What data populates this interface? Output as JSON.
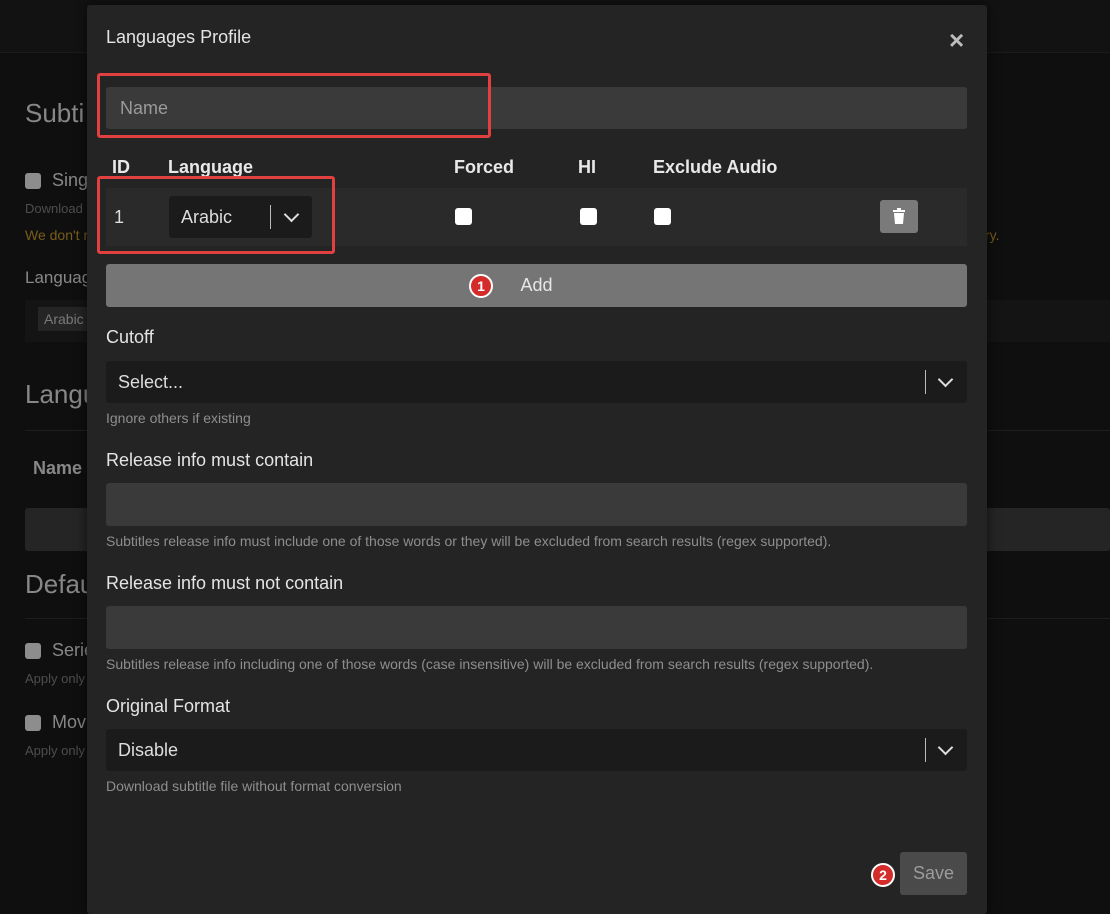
{
  "background": {
    "heading_subtitles": "Subti",
    "single_label": "Sing",
    "download_hint": "Download",
    "warning_left": "We don't r",
    "warning_right": "ry.",
    "languages_label": "Languag",
    "language_tag": "Arabic",
    "heading_languages": "Langu",
    "name_column": "Name",
    "heading_defaults": "Defau",
    "series_label": "Serie",
    "apply_only_1": "Apply only",
    "movies_label": "Mov",
    "apply_only_2": "Apply only"
  },
  "modal": {
    "title": "Languages Profile",
    "close_symbol": "×",
    "name_placeholder": "Name",
    "table": {
      "headers": {
        "id": "ID",
        "language": "Language",
        "forced": "Forced",
        "hi": "HI",
        "exclude_audio": "Exclude Audio"
      },
      "rows": [
        {
          "id": "1",
          "language": "Arabic",
          "forced": false,
          "hi": false,
          "exclude_audio": false
        }
      ]
    },
    "add_label": "Add",
    "cutoff": {
      "label": "Cutoff",
      "value": "Select...",
      "hint": "Ignore others if existing"
    },
    "must_contain": {
      "label": "Release info must contain",
      "value": "",
      "hint": "Subtitles release info must include one of those words or they will be excluded from search results (regex supported)."
    },
    "must_not_contain": {
      "label": "Release info must not contain",
      "value": "",
      "hint": "Subtitles release info including one of those words (case insensitive) will be excluded from search results (regex supported)."
    },
    "original_format": {
      "label": "Original Format",
      "value": "Disable",
      "hint": "Download subtitle file without format conversion"
    },
    "save_label": "Save"
  },
  "annotations": {
    "badge_1": "1",
    "badge_2": "2",
    "highlight_color": "#e04040"
  }
}
